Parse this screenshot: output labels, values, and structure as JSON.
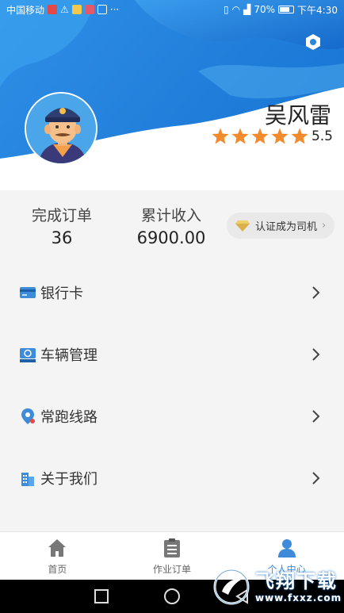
{
  "status_bar": {
    "carrier": "中国移动",
    "more": "···",
    "battery": "70%",
    "time": "下午4:30"
  },
  "profile": {
    "name": "吴风雷",
    "rating": "5.5",
    "stars": 5
  },
  "stats": {
    "orders_label": "完成订单",
    "orders_value": "36",
    "income_label": "累计收入",
    "income_value": "6900.00",
    "certify_label": "认证成为司机"
  },
  "menu": {
    "items": [
      {
        "label": "银行卡",
        "icon": "bank-card-icon"
      },
      {
        "label": "车辆管理",
        "icon": "vehicle-icon"
      },
      {
        "label": "常跑线路",
        "icon": "location-pin-icon"
      },
      {
        "label": "关于我们",
        "icon": "building-icon"
      }
    ]
  },
  "tabbar": {
    "tabs": [
      {
        "label": "首页",
        "icon": "home-icon"
      },
      {
        "label": "作业订单",
        "icon": "clipboard-icon"
      },
      {
        "label": "个人中心",
        "icon": "person-icon"
      }
    ]
  },
  "watermark": {
    "main": "飞翔下载",
    "sub": "www.fxxz.com"
  },
  "colors": {
    "accent": "#3d8bd9",
    "header_blue": "#1e7fd8",
    "star": "#f28a2e"
  }
}
